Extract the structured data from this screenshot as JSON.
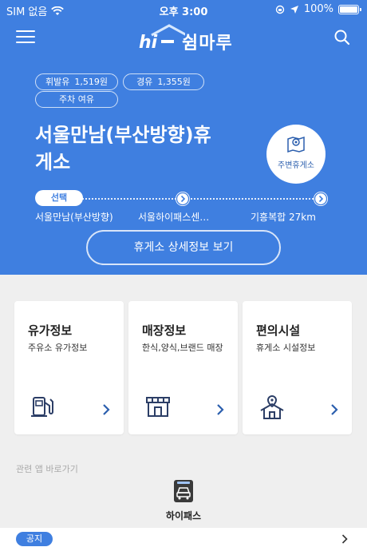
{
  "status_bar": {
    "carrier": "SIM 없음",
    "time": "오후 3:00",
    "battery": "100%"
  },
  "header": {
    "logo_text": "쉼마루",
    "menu_icon": "hamburger-icon",
    "search_icon": "search-icon"
  },
  "fuel_prices": {
    "gasoline_label": "휘발유",
    "gasoline_price": "1,519원",
    "diesel_label": "경유",
    "diesel_price": "1,355원"
  },
  "parking_status": "주차 여유",
  "rest_area": {
    "name_line1": "서울만남(부산방향)휴",
    "name_line2": "게소"
  },
  "nearby_button": {
    "label": "주변휴게소",
    "icon": "map-pin-icon"
  },
  "route": {
    "selected_chip": "선택",
    "stops": [
      {
        "name": "서울만남(부산방향)"
      },
      {
        "name": "서울하이패스센…"
      },
      {
        "name": "기흥복합 27km"
      }
    ]
  },
  "detail_button": "휴게소 상세정보 보기",
  "cards": [
    {
      "title": "유가정보",
      "desc": "주유소 유가정보",
      "icon": "fuel-pump-icon"
    },
    {
      "title": "매장정보",
      "desc": "한식,양식,브랜드 매장",
      "icon": "store-icon"
    },
    {
      "title": "편의시설",
      "desc": "휴게소 시설정보",
      "icon": "location-home-icon"
    }
  ],
  "related_apps": {
    "title": "관련 앱 바로가기",
    "apps": [
      {
        "label": "하이패스",
        "icon": "hipass-car-icon"
      }
    ]
  },
  "notice": {
    "badge": "공지"
  },
  "colors": {
    "primary": "#3f7fe0",
    "background": "#efefef",
    "icon_dark": "#2c3e66",
    "arrow_blue": "#2c5fae"
  }
}
